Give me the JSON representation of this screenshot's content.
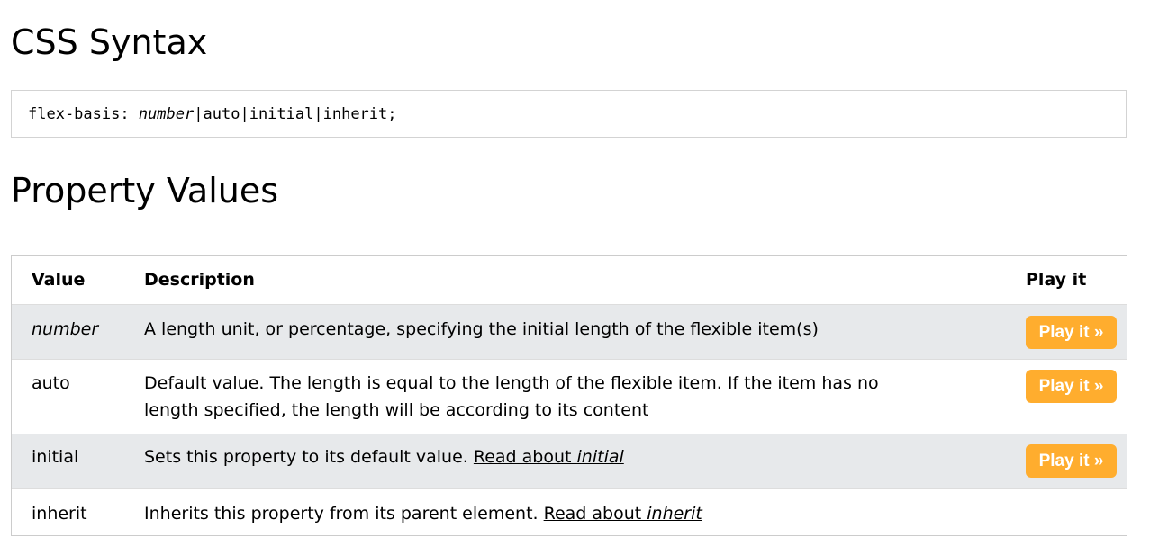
{
  "headings": {
    "syntax": "CSS Syntax",
    "values": "Property Values"
  },
  "syntax": {
    "prop": "flex-basis: ",
    "number": "number",
    "sep1": "|",
    "auto": "auto",
    "sep2": "|",
    "initial": "initial",
    "sep3": "|",
    "inherit": "inherit;"
  },
  "table": {
    "headers": {
      "value": "Value",
      "description": "Description",
      "play": "Play it"
    },
    "rows": [
      {
        "value": "number",
        "description": "A length unit, or percentage, specifying the initial length of the flexible item(s)",
        "play": "Play it »"
      },
      {
        "value": "auto",
        "description_line1": "Default value. The length is equal to the length of the flexible item. If the item has no",
        "description_line2": "length specified, the length will be according to its content",
        "play": "Play it »"
      },
      {
        "value": "initial",
        "description": "Sets this property to its default value. ",
        "link_prefix": "Read about ",
        "link_term": "initial",
        "play": "Play it »"
      },
      {
        "value": "inherit",
        "description": "Inherits this property from its parent element. ",
        "link_prefix": "Read about ",
        "link_term": "inherit"
      }
    ]
  },
  "colors": {
    "button": "#ffad2e",
    "stripe": "#e7e9eb"
  }
}
